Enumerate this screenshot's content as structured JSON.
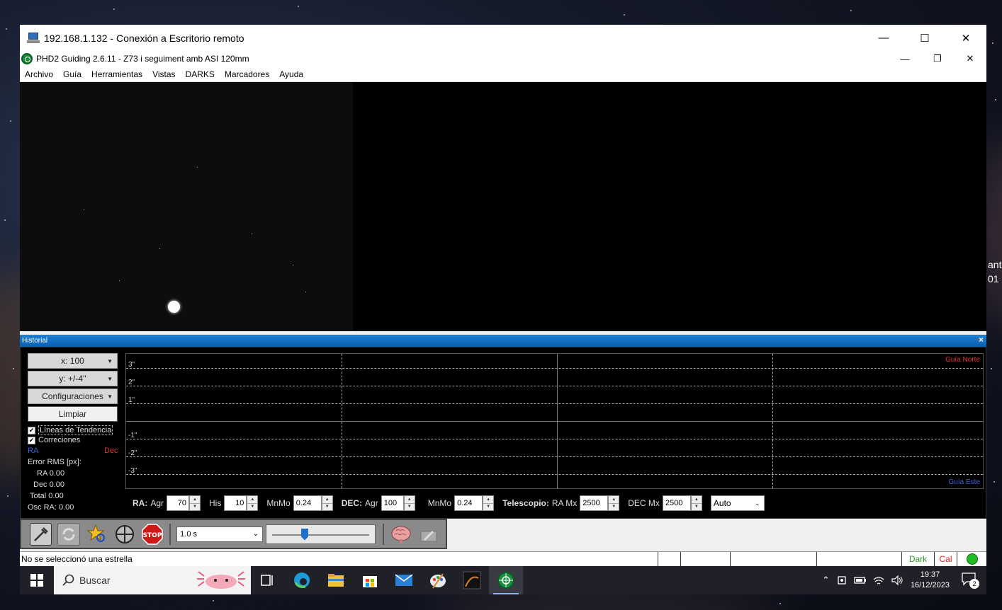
{
  "rdp": {
    "title": "192.168.1.132 - Conexión a Escritorio remoto",
    "minimize": "—",
    "maximize": "☐",
    "close": "✕"
  },
  "app": {
    "title": "PHD2 Guiding 2.6.11 - Z73 i seguiment amb ASI 120mm",
    "minimize": "—",
    "restore": "❐",
    "close": "✕"
  },
  "menu": [
    "Archivo",
    "Guía",
    "Herramientas",
    "Vistas",
    "DARKS",
    "Marcadores",
    "Ayuda"
  ],
  "history": {
    "title": "Historial",
    "close": "×",
    "x_scale": "x: 100",
    "y_scale": "y: +/-4''",
    "settings": "Configuraciones",
    "clear": "Limpiar",
    "trend_lines": "Líneas de Tendencia",
    "corrections": "Correciones",
    "ra_label": "RA",
    "dec_label": "Dec",
    "rms_title": "Error RMS [px]:",
    "ra_rms": "RA 0.00",
    "dec_rms": "Dec 0.00",
    "total_rms": "Total 0.00",
    "osc_ra": "Osc RA: 0.00",
    "graph": {
      "labels_top": [
        "3\"",
        "2\"",
        "1\""
      ],
      "labels_bottom": [
        "-1\"",
        "-2\"",
        "-3\""
      ],
      "north": "Guía Norte",
      "east": "Guía Este"
    }
  },
  "params": {
    "ra": "RA:",
    "agr": "Agr",
    "ra_agr": "70",
    "his": "His",
    "ra_his": "10",
    "mnmo": "MnMo",
    "ra_mnmo": "0.24",
    "dec": "DEC:",
    "dec_agr": "100",
    "dec_mnmo": "0.24",
    "telescope": "Telescopio:",
    "ra_mx": "RA Mx",
    "ra_mx_val": "2500",
    "dec_mx": "DEC Mx",
    "dec_mx_val": "2500",
    "mode": "Auto"
  },
  "toolbar": {
    "exposure": "1.0 s"
  },
  "status": {
    "message": "No se seleccionó una estrella",
    "dark": "Dark",
    "cal": "Cal",
    "dark_color": "#2a9a2a",
    "cal_color": "#e02020",
    "indicator_color": "#22bb22"
  },
  "taskbar": {
    "search": "Buscar",
    "time": "19:37",
    "date": "16/12/2023",
    "notifications": "2"
  },
  "edge_text": [
    "ant",
    "01"
  ]
}
